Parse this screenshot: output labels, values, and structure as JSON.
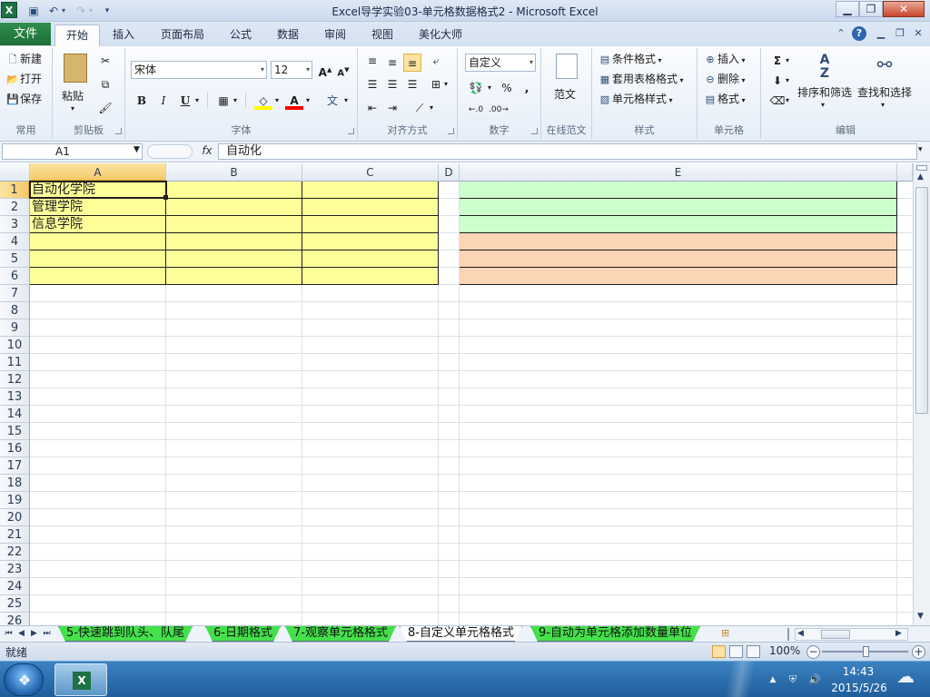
{
  "window": {
    "app_icon": "X",
    "title": "Excel导学实验03-单元格数据格式2 - Microsoft Excel",
    "qat_icons": [
      "save-icon",
      "undo-icon",
      "redo-icon",
      "customize-qat-icon"
    ]
  },
  "ribbon_tabs": {
    "file": "文件",
    "tabs": [
      "开始",
      "插入",
      "页面布局",
      "公式",
      "数据",
      "审阅",
      "视图",
      "美化大师"
    ],
    "active": "开始"
  },
  "groups": {
    "common": {
      "label": "常用",
      "new": "新建",
      "open": "打开",
      "save": "保存"
    },
    "clipboard": {
      "label": "剪贴板",
      "paste": "粘贴"
    },
    "font": {
      "label": "字体",
      "font_name": "宋体",
      "font_size": "12",
      "bold": "B",
      "italic": "I",
      "underline": "U"
    },
    "alignment": {
      "label": "对齐方式"
    },
    "number": {
      "label": "数字",
      "format": "自定义",
      "percent": "%",
      "comma": ","
    },
    "template": {
      "label": "在线范文",
      "button": "范文"
    },
    "styles": {
      "label": "样式",
      "conditional": "条件格式",
      "table_format": "套用表格格式",
      "cell_styles": "单元格样式"
    },
    "cells": {
      "label": "单元格",
      "insert": "插入",
      "delete": "删除",
      "format": "格式"
    },
    "editing": {
      "label": "编辑",
      "sort_filter": "排序和筛选",
      "find_select": "查找和选择"
    }
  },
  "formula_bar": {
    "name_box": "A1",
    "fx": "fx",
    "value": "自动化"
  },
  "sheet": {
    "columns": [
      "A",
      "B",
      "C",
      "D",
      "E"
    ],
    "rows": [
      "1",
      "2",
      "3",
      "4",
      "5",
      "6",
      "7",
      "8",
      "9",
      "10",
      "11",
      "12",
      "13",
      "14",
      "15",
      "16",
      "17",
      "18",
      "19",
      "20",
      "21",
      "22",
      "23",
      "24",
      "25",
      "26"
    ],
    "cells": {
      "A1": "自动化学院",
      "A2": "管理学院",
      "A3": "信息学院"
    },
    "colors": {
      "yellow": "#ffff99",
      "green": "#ccffcc",
      "orange": "#fcd5b4"
    }
  },
  "sheet_tabs": {
    "tabs": [
      "5-快速跳到队头、队尾",
      "6-日期格式",
      "7-观察单元格格式",
      "8-自定义单元格格式",
      "9-自动为单元格添加数量单位"
    ],
    "active": "8-自定义单元格格式",
    "tab_color": "#44e14a"
  },
  "status": {
    "text": "就绪",
    "zoom": "100%"
  },
  "taskbar": {
    "time": "14:43",
    "date": "2015/5/26"
  }
}
